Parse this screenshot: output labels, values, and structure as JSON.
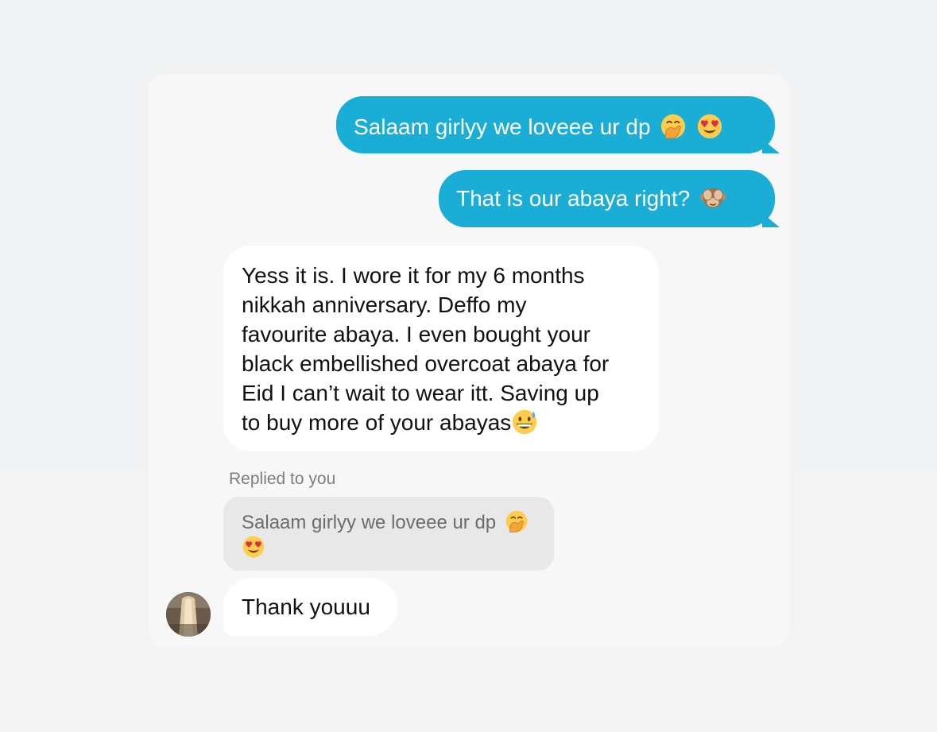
{
  "messages": {
    "sent_1": {
      "text": "Salaam girlyy we loveee ur dp",
      "emojis": [
        "hand-over-mouth-emoji",
        "heart-eyes-emoji"
      ]
    },
    "sent_2": {
      "text": "That is our abaya right?",
      "emojis": [
        "see-no-evil-monkey-emoji"
      ]
    },
    "received_1": {
      "lines": [
        "Yess it is. I wore it for my 6 months",
        "nikkah anniversary. Deffo my",
        "favourite abaya. I even bought your",
        "black embellished overcoat abaya for",
        "Eid I can’t wait to wear itt. Saving up",
        "to buy more of your abayas"
      ],
      "emojis": [
        "grinning-sweat-emoji"
      ]
    },
    "reply": {
      "label": "Replied to you",
      "quoted_text": "Salaam girlyy we loveee ur dp",
      "emojis": [
        "hand-over-mouth-emoji",
        "heart-eyes-emoji"
      ]
    },
    "received_2": {
      "text": "Thank youuu"
    }
  },
  "colors": {
    "outgoing_bubble": "#1aaed6",
    "incoming_bubble": "#ffffff",
    "quote_bubble": "#e8e8e8",
    "panel": "#f7f7f7",
    "background": "#f1f2f3"
  }
}
